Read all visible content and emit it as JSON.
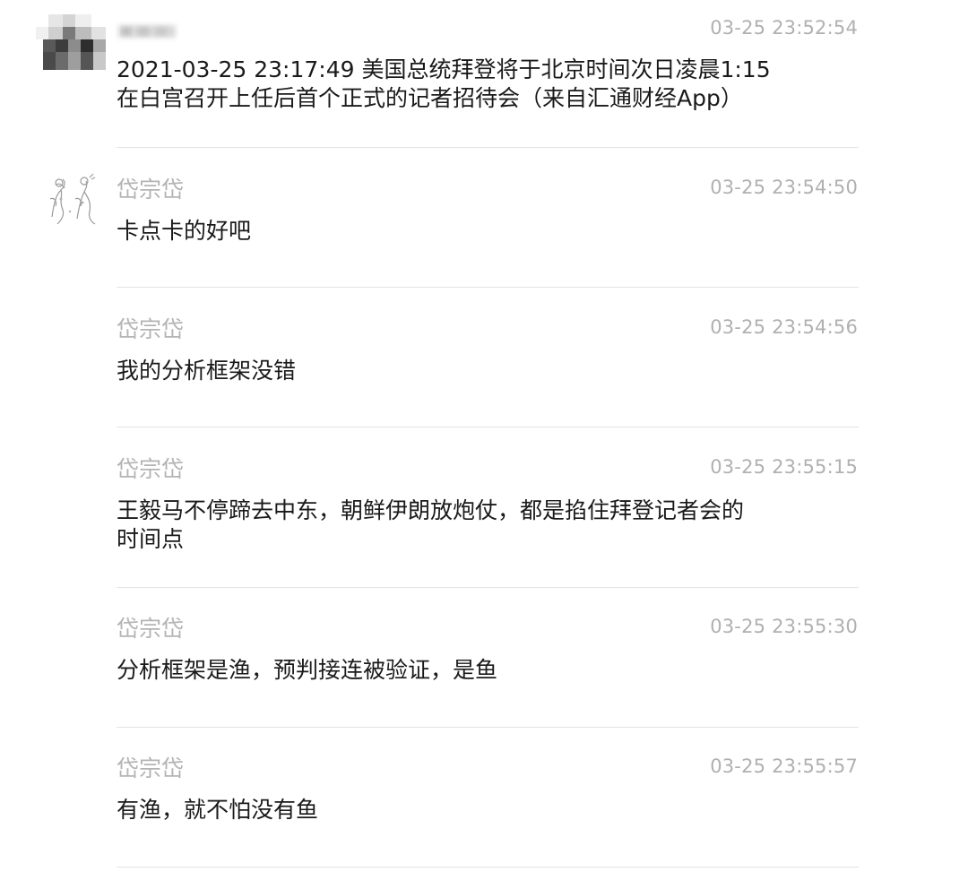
{
  "messages": [
    {
      "sender": "",
      "time": "03-25 23:52:54",
      "text_line1": "2021-03-25 23:17:49 美国总统拜登将于北京时间次日凌晨1:15",
      "text_line2": "在白宫召开上任后首个正式的记者招待会（来自汇通财经App）",
      "avatar": "pixelated-avatar"
    },
    {
      "sender": "岱宗岱",
      "time": "03-25 23:54:50",
      "text": "卡点卡的好吧",
      "avatar": "sketch-avatar"
    },
    {
      "sender": "岱宗岱",
      "time": "03-25 23:54:56",
      "text": "我的分析框架没错"
    },
    {
      "sender": "岱宗岱",
      "time": "03-25 23:55:15",
      "text_line1": "王毅马不停蹄去中东，朝鲜伊朗放炮仗，都是掐住拜登记者会的",
      "text_line2": "时间点"
    },
    {
      "sender": "岱宗岱",
      "time": "03-25 23:55:30",
      "text": "分析框架是渔，预判接连被验证，是鱼"
    },
    {
      "sender": "岱宗岱",
      "time": "03-25 23:55:57",
      "text": "有渔，就不怕没有鱼"
    }
  ]
}
